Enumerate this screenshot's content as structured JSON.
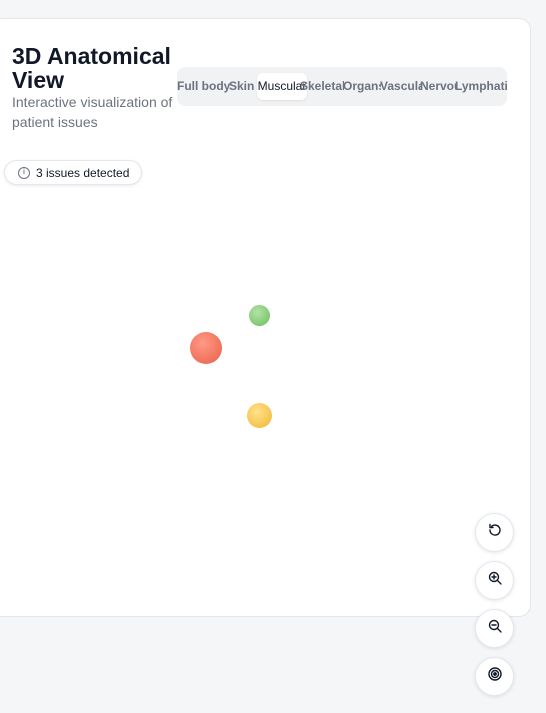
{
  "header": {
    "title": "3D Anatomical View",
    "subtitle": "Interactive visualization of patient issues"
  },
  "tabs": [
    {
      "label": "Full body",
      "active": false
    },
    {
      "label": "Skin",
      "active": false
    },
    {
      "label": "Muscular",
      "active": true
    },
    {
      "label": "Skeletal",
      "active": false
    },
    {
      "label": "Organs",
      "active": false
    },
    {
      "label": "Vascular",
      "active": false
    },
    {
      "label": "Nervous",
      "active": false
    },
    {
      "label": "Lymphatic",
      "active": false
    }
  ],
  "badge": {
    "icon": "info-icon",
    "label": "3 issues detected"
  },
  "markers": [
    {
      "name": "issue-marker-green",
      "color": "#7fc870"
    },
    {
      "name": "issue-marker-red",
      "color": "#f0705a"
    },
    {
      "name": "issue-marker-yellow",
      "color": "#f5c24e"
    }
  ],
  "controls": [
    {
      "name": "reset-view-button",
      "icon": "rotate-ccw-icon"
    },
    {
      "name": "zoom-in-button",
      "icon": "zoom-in-icon"
    },
    {
      "name": "zoom-out-button",
      "icon": "zoom-out-icon"
    },
    {
      "name": "focus-button",
      "icon": "target-icon"
    }
  ]
}
